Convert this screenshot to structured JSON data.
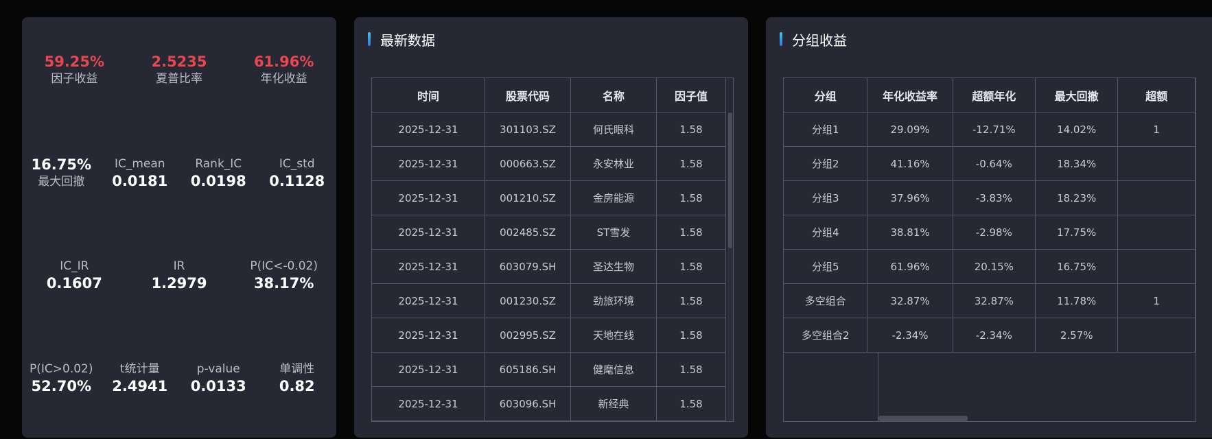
{
  "stats": {
    "row1": [
      {
        "value": "59.25%",
        "label": "因子收益"
      },
      {
        "value": "2.5235",
        "label": "夏普比率"
      },
      {
        "value": "61.96%",
        "label": "年化收益"
      }
    ],
    "row2": [
      {
        "value": "16.75%",
        "label": "最大回撤"
      },
      {
        "label": "IC_mean",
        "value": "0.0181"
      },
      {
        "label": "Rank_IC",
        "value": "0.0198"
      },
      {
        "label": "IC_std",
        "value": "0.1128"
      }
    ],
    "row3": [
      {
        "label": "IC_IR",
        "value": "0.1607"
      },
      {
        "label": "IR",
        "value": "1.2979"
      },
      {
        "label": "P(IC<-0.02)",
        "value": "38.17%"
      }
    ],
    "row4": [
      {
        "label": "P(IC>0.02)",
        "value": "52.70%"
      },
      {
        "label": "t统计量",
        "value": "2.4941"
      },
      {
        "label": "p-value",
        "value": "0.0133"
      },
      {
        "label": "单调性",
        "value": "0.82"
      }
    ],
    "highlight_color": "#e8474f"
  },
  "latest": {
    "title": "最新数据",
    "columns": [
      "时间",
      "股票代码",
      "名称",
      "因子值"
    ],
    "rows": [
      [
        "2025-12-31",
        "301103.SZ",
        "何氏眼科",
        "1.58"
      ],
      [
        "2025-12-31",
        "000663.SZ",
        "永安林业",
        "1.58"
      ],
      [
        "2025-12-31",
        "001210.SZ",
        "金房能源",
        "1.58"
      ],
      [
        "2025-12-31",
        "002485.SZ",
        "ST雪发",
        "1.58"
      ],
      [
        "2025-12-31",
        "603079.SH",
        "圣达生物",
        "1.58"
      ],
      [
        "2025-12-31",
        "001230.SZ",
        "劲旅环境",
        "1.58"
      ],
      [
        "2025-12-31",
        "002995.SZ",
        "天地在线",
        "1.58"
      ],
      [
        "2025-12-31",
        "605186.SH",
        "健麾信息",
        "1.58"
      ],
      [
        "2025-12-31",
        "603096.SH",
        "新经典",
        "1.58"
      ]
    ]
  },
  "group": {
    "title": "分组收益",
    "columns": [
      "分组",
      "年化收益率",
      "超额年化",
      "最大回撤",
      "超额"
    ],
    "rows": [
      [
        "分组1",
        "29.09%",
        "-12.71%",
        "14.02%",
        "1"
      ],
      [
        "分组2",
        "41.16%",
        "-0.64%",
        "18.34%",
        ""
      ],
      [
        "分组3",
        "37.96%",
        "-3.83%",
        "18.23%",
        ""
      ],
      [
        "分组4",
        "38.81%",
        "-2.98%",
        "17.75%",
        ""
      ],
      [
        "分组5",
        "61.96%",
        "20.15%",
        "16.75%",
        ""
      ],
      [
        "多空组合",
        "32.87%",
        "32.87%",
        "11.78%",
        "1"
      ],
      [
        "多空组合2",
        "-2.34%",
        "-2.34%",
        "2.57%",
        ""
      ]
    ]
  }
}
